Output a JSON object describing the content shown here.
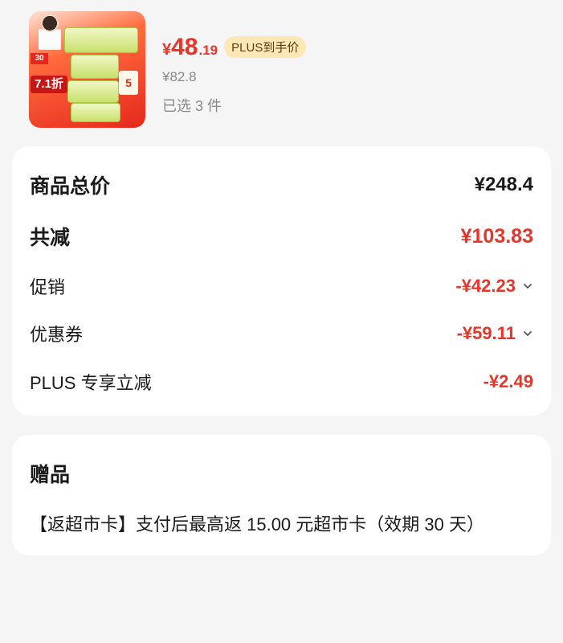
{
  "product": {
    "thumbnail_icon": "tissue-product-image",
    "thumbnail_texts": {
      "badge": "30",
      "discount": "7.1折",
      "pack_count": "5"
    },
    "price": {
      "currency": "¥",
      "integer": "48",
      "decimal": ".19",
      "badge": "PLUS到手价"
    },
    "original_price": "¥82.8",
    "selected_count": "已选 3 件"
  },
  "summary": {
    "rows": [
      {
        "label": "商品总价",
        "value": "¥248.4"
      },
      {
        "label": "共减",
        "value": "¥103.83"
      },
      {
        "label": "促销",
        "value": "-¥42.23"
      },
      {
        "label": "优惠券",
        "value": "-¥59.11"
      },
      {
        "label": "PLUS 专享立减",
        "value": "-¥2.49"
      }
    ]
  },
  "gift": {
    "title": "赠品",
    "text": "【返超市卡】支付后最高返 15.00 元超市卡（效期 30 天）"
  },
  "colors": {
    "accent_red": "#e8352a",
    "plus_badge_bg": "#fbe8b5",
    "page_bg": "#f5f5f5",
    "card_bg": "#ffffff"
  }
}
